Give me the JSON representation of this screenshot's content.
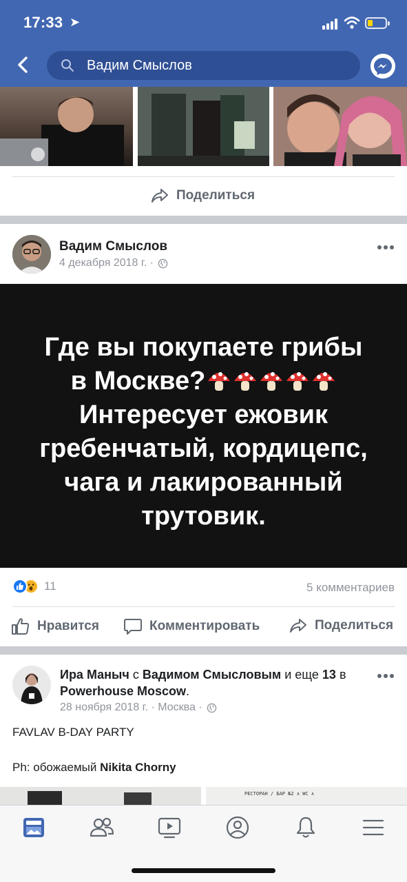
{
  "status_bar": {
    "time": "17:33"
  },
  "header": {
    "search_query": "Вадим Смыслов"
  },
  "top_post": {
    "share_label": "Поделиться"
  },
  "post1": {
    "author": "Вадим Смыслов",
    "date": "4 декабря 2018 г. ·",
    "image_lines": [
      "Где вы покупаете грибы",
      "в Москве?",
      "Интересует ежовик",
      "гребенчатый, кордицепс,",
      "чага и лакированный",
      "трутовик."
    ],
    "reaction_count": "11",
    "comments_count": "5 комментариев",
    "actions": {
      "like": "Нравится",
      "comment": "Комментировать",
      "share": "Поделиться"
    }
  },
  "post2": {
    "author": "Ира Маныч",
    "with_prefix": "с",
    "with_name": "Вадимом Смысловым",
    "and_text": "и еще",
    "others": "13",
    "in_text": "в",
    "place": "Powerhouse Moscow",
    "period": ".",
    "date": "28 ноября 2018 г. · Москва ·",
    "text_line1": "FAVLAV B-DAY PARTY",
    "text_line2_prefix": "Ph: обожаемый",
    "text_line2_name": "Nikita Chorny",
    "sign_text": "РЕСТОРАН / БАР №2 ∧ WC ∧"
  },
  "colors": {
    "brand": "#4267b2",
    "search_bg": "#2f4f94",
    "like_blue": "#1877f2",
    "wow_yellow": "#f7b125"
  },
  "tabs": [
    {
      "name": "news-feed",
      "active": true
    },
    {
      "name": "friends",
      "active": false
    },
    {
      "name": "watch",
      "active": false
    },
    {
      "name": "profile",
      "active": false
    },
    {
      "name": "notifications",
      "active": false
    },
    {
      "name": "menu",
      "active": false
    }
  ]
}
